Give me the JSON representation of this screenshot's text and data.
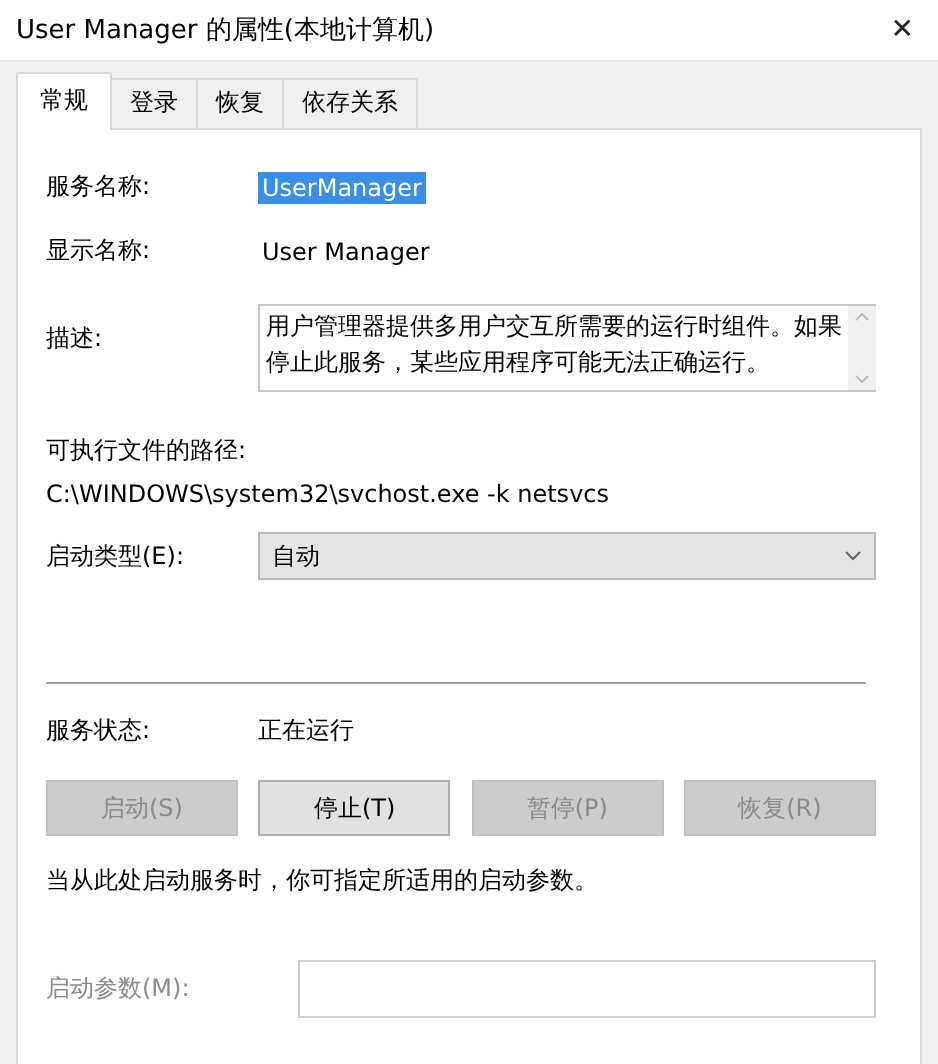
{
  "window": {
    "title": "User Manager 的属性(本地计算机)",
    "close": "✕"
  },
  "tabs": [
    {
      "label": "常规",
      "selected": true
    },
    {
      "label": "登录",
      "selected": false
    },
    {
      "label": "恢复",
      "selected": false
    },
    {
      "label": "依存关系",
      "selected": false
    }
  ],
  "fields": [
    {
      "kind": "text",
      "label": "服务名称:",
      "value": "UserManager",
      "selected": true
    },
    {
      "kind": "text",
      "label": "显示名称:",
      "value": "User Manager",
      "selected": false
    },
    {
      "kind": "textarea",
      "label": "描述:",
      "value": "用户管理器提供多用户交互所需要的运行时组件。如果停止此服务，某些应用程序可能无法正确运行。"
    }
  ],
  "path": {
    "label": "可执行文件的路径:",
    "value": "C:\\WINDOWS\\system32\\svchost.exe -k netsvcs"
  },
  "startup_type": {
    "label": "启动类型(E):",
    "value": "自动"
  },
  "status": {
    "label": "服务状态:",
    "value": "正在运行"
  },
  "buttons": [
    {
      "label": "启动(S)",
      "disabled": true
    },
    {
      "label": "停止(T)",
      "disabled": false
    },
    {
      "label": "暂停(P)",
      "disabled": true
    },
    {
      "label": "恢复(R)",
      "disabled": true
    }
  ],
  "note": "当从此处启动服务时，你可指定所适用的启动参数。",
  "start_params": {
    "label": "启动参数(M):",
    "disabled": true
  }
}
